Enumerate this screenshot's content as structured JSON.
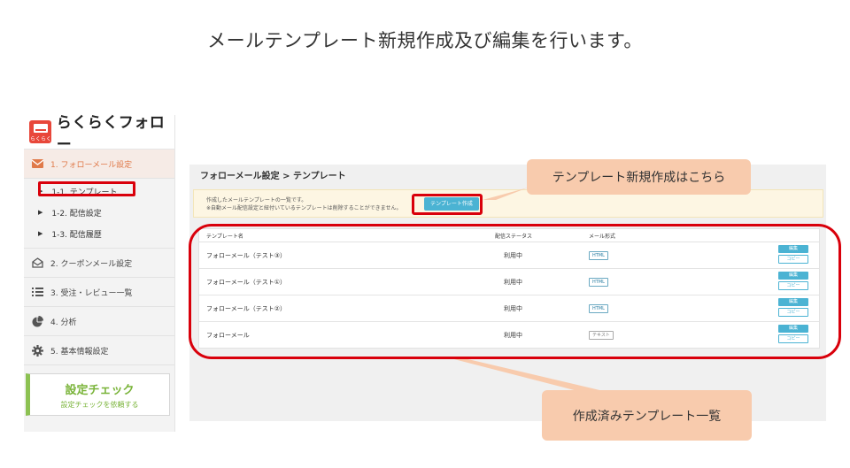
{
  "slide_title": "メールテンプレート新規作成及び編集を行います。",
  "sidebar": {
    "logo_text": "らくらくフォロー",
    "logo_sub": "らくらく",
    "menu": {
      "follow_mail": "1. フォローメール設定",
      "sub_items": [
        "1-1. テンプレート",
        "1-2. 配信設定",
        "1-3. 配信履歴"
      ],
      "coupon_mail": "2. クーポンメール設定",
      "orders": "3. 受注・レビュー一覧",
      "analysis": "4. 分析",
      "basic_info": "5. 基本情報設定"
    },
    "check": {
      "title": "設定チェック",
      "subtitle": "設定チェックを依頼する"
    }
  },
  "content": {
    "breadcrumb": "フォローメール設定 > テンプレート",
    "info_line1": "作成したメールテンプレートの一覧です。",
    "info_line2": "※自動メール配信設定と紐付いているテンプレートは削除することができません。",
    "new_template_button": "テンプレート作成",
    "table": {
      "headers": {
        "name": "テンプレート名",
        "status": "配信ステータス",
        "format": "メール形式"
      },
      "rows": [
        {
          "name": "フォローメール（テスト③）",
          "status": "利用中",
          "format": "HTML"
        },
        {
          "name": "フォローメール（テスト①）",
          "status": "利用中",
          "format": "HTML"
        },
        {
          "name": "フォローメール（テスト②）",
          "status": "利用中",
          "format": "HTML"
        },
        {
          "name": "フォローメール",
          "status": "利用中",
          "format": "テキスト"
        }
      ],
      "edit_label": "編集",
      "copy_label": "コピー"
    }
  },
  "callouts": {
    "new_template": "テンプレート新規作成はこちら",
    "template_list": "作成済みテンプレート一覧"
  },
  "colors": {
    "accent_orange": "#e07a4a",
    "button_blue": "#4bb3d3",
    "highlight_red": "#d9000b",
    "callout_bg": "#f8cbad",
    "check_green": "#8cc152"
  }
}
